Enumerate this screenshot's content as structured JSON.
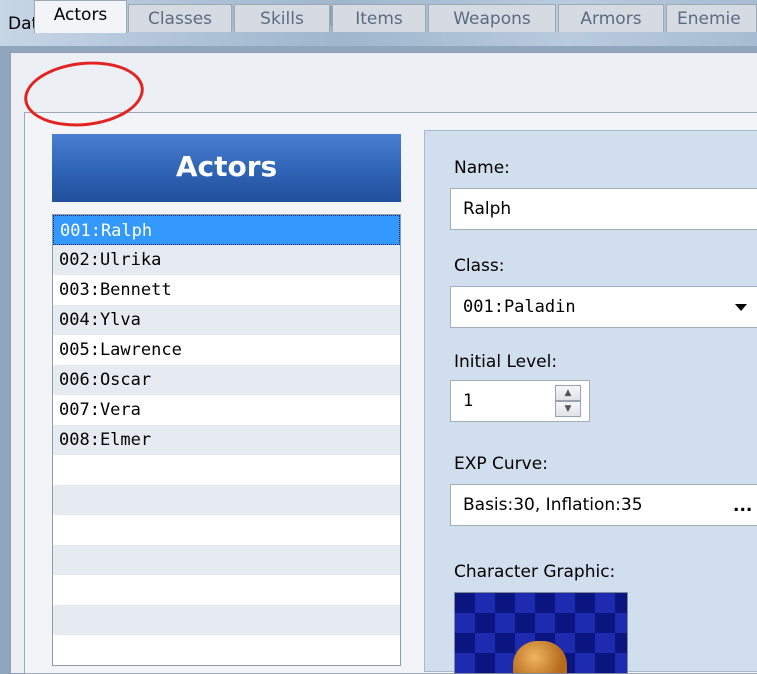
{
  "window": {
    "title": "Database"
  },
  "tabs": [
    {
      "label": "Actors",
      "active": true
    },
    {
      "label": "Classes",
      "active": false
    },
    {
      "label": "Skills",
      "active": false
    },
    {
      "label": "Items",
      "active": false
    },
    {
      "label": "Weapons",
      "active": false
    },
    {
      "label": "Armors",
      "active": false
    },
    {
      "label": "Enemie",
      "active": false
    }
  ],
  "actors_panel": {
    "header": "Actors",
    "items": [
      "001:Ralph",
      "002:Ulrika",
      "003:Bennett",
      "004:Ylva",
      "005:Lawrence",
      "006:Oscar",
      "007:Vera",
      "008:Elmer"
    ],
    "selected_index": 0
  },
  "details": {
    "name_label": "Name:",
    "name_value": "Ralph",
    "class_label": "Class:",
    "class_value": "001:Paladin",
    "initial_level_label": "Initial Level:",
    "initial_level_value": "1",
    "exp_curve_label": "EXP Curve:",
    "exp_curve_value": "Basis:30, Inflation:35",
    "exp_curve_button": "...",
    "character_graphic_label": "Character Graphic:"
  },
  "colors": {
    "selection": "#3399ff",
    "header_blue": "#2f63b5",
    "highlight_circle": "#e32222"
  }
}
